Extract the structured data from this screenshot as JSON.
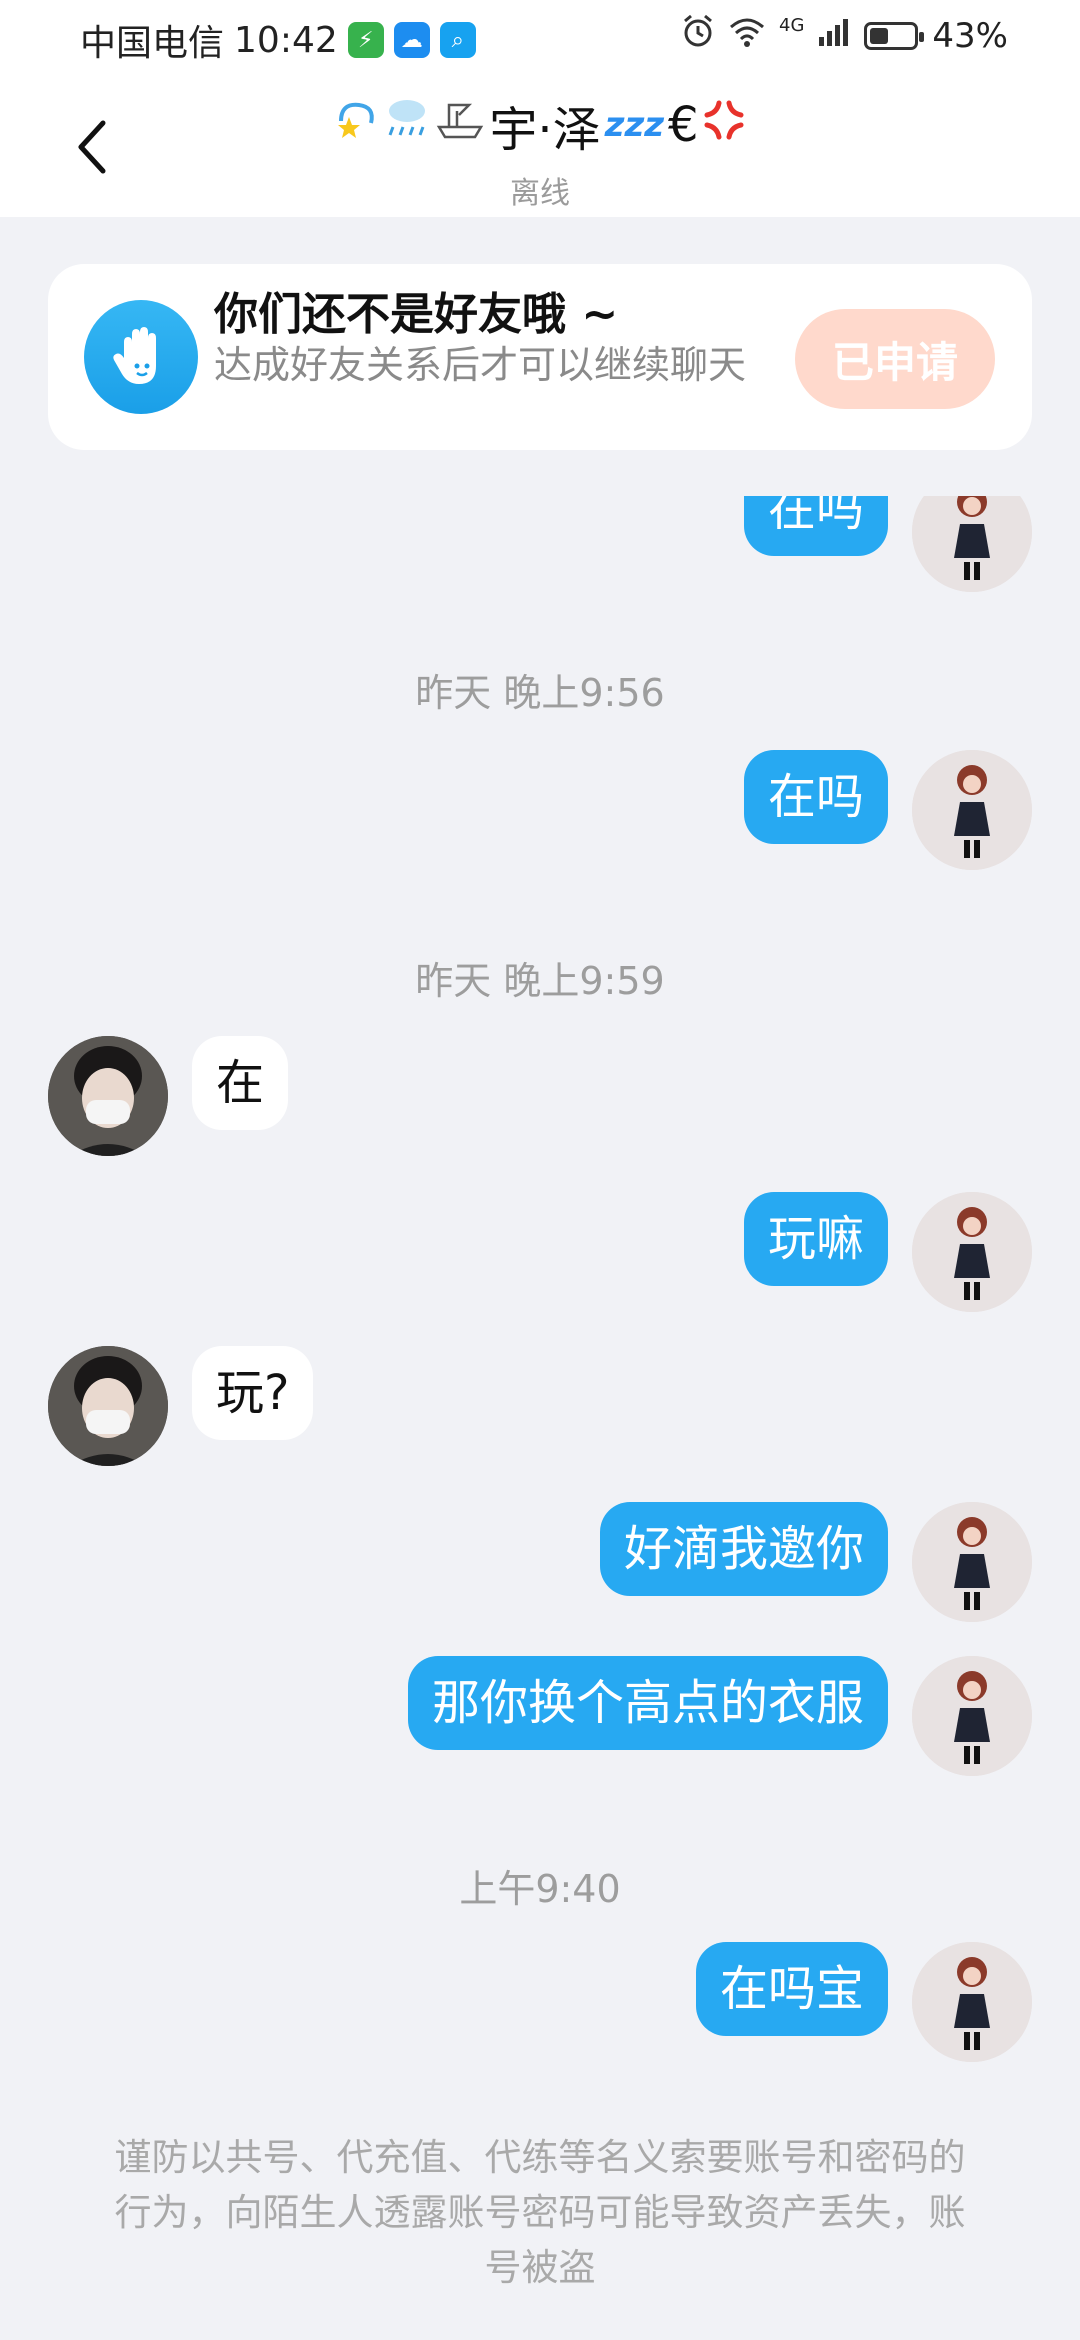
{
  "status_bar": {
    "carrier": "中国电信",
    "time": "10:42",
    "network": "4G",
    "battery": "43%",
    "battery_level": 0.43,
    "icons": [
      "charging-app-icon",
      "weather-app-icon",
      "search-app-icon",
      "alarm-icon",
      "wifi-icon",
      "signal-icon",
      "battery-icon"
    ]
  },
  "header": {
    "back_icon": "chevron-left-icon",
    "name": "宇·泽",
    "name_emojis_before": [
      "dizzy-icon",
      "rain-cloud-icon",
      "ship-icon"
    ],
    "name_emojis_after": [
      "zzz-icon",
      "€",
      "anger-icon"
    ],
    "status": "离线"
  },
  "notice": {
    "icon": "hand-wave-icon",
    "title": "你们还不是好友哦 ~",
    "description": "达成好友关系后才可以继续聊天",
    "button": "已申请"
  },
  "messages": [
    {
      "kind": "msg",
      "side": "me",
      "text": "在吗"
    },
    {
      "kind": "time",
      "text": "昨天 晚上9:56"
    },
    {
      "kind": "msg",
      "side": "me",
      "text": "在吗"
    },
    {
      "kind": "time",
      "text": "昨天 晚上9:59"
    },
    {
      "kind": "msg",
      "side": "peer",
      "text": "在"
    },
    {
      "kind": "msg",
      "side": "me",
      "text": "玩嘛"
    },
    {
      "kind": "msg",
      "side": "peer",
      "text": "玩?"
    },
    {
      "kind": "msg",
      "side": "me",
      "text": "好滴我邀你"
    },
    {
      "kind": "msg",
      "side": "me",
      "text": "那你换个高点的衣服"
    },
    {
      "kind": "time",
      "text": "上午9:40"
    },
    {
      "kind": "msg",
      "side": "me",
      "text": "在吗宝"
    }
  ],
  "warning": "谨防以共号、代充值、代练等名义索要账号和密码的行为，向陌生人透露账号密码可能导致资产丢失，账号被盗",
  "colors": {
    "accent": "#27a9f2",
    "apply_button": "#ffd9cc",
    "background": "#f1f2f6"
  }
}
